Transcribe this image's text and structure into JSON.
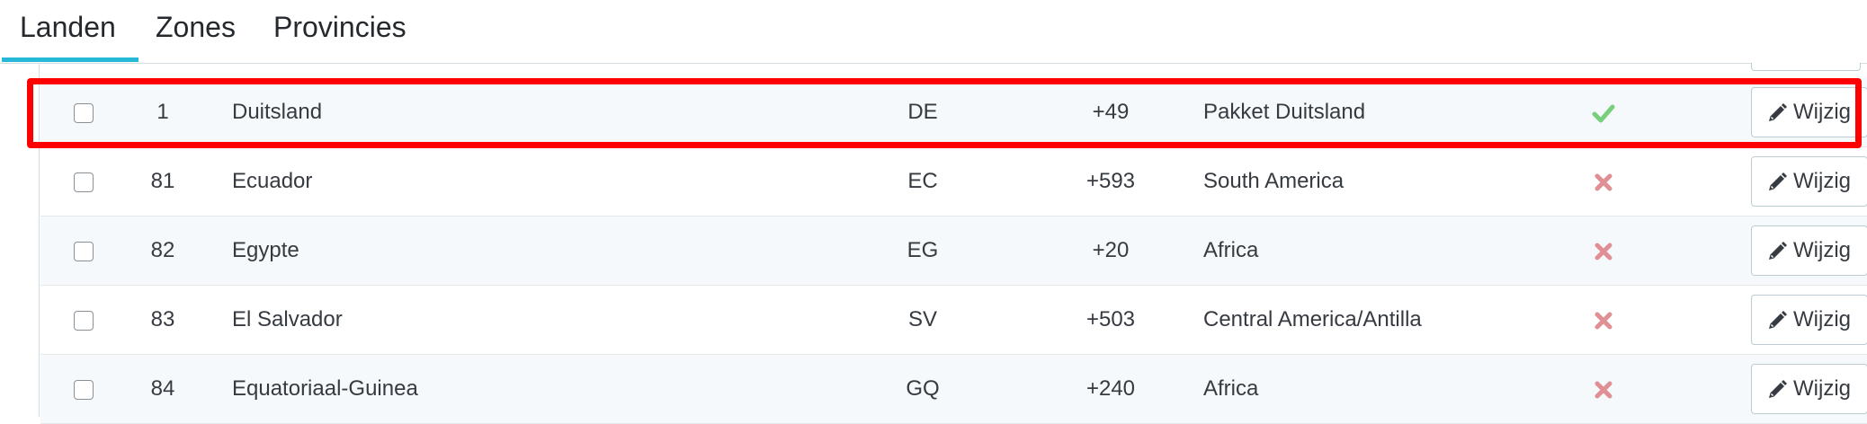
{
  "tabs": [
    {
      "label": "Landen",
      "active": true
    },
    {
      "label": "Zones",
      "active": false
    },
    {
      "label": "Provincies",
      "active": false
    }
  ],
  "colors": {
    "accent": "#25b9d7",
    "check": "#78d07d",
    "cross": "#e08f95",
    "highlight": "#ff0000"
  },
  "table": {
    "edit_label": "Wijzig",
    "rows": [
      {
        "id": "1",
        "name": "Duitsland",
        "iso": "DE",
        "call_prefix": "+49",
        "zone": "Pakket Duitsland",
        "enabled": true,
        "status_icon": "check-icon"
      },
      {
        "id": "81",
        "name": "Ecuador",
        "iso": "EC",
        "call_prefix": "+593",
        "zone": "South America",
        "enabled": false,
        "status_icon": "cross-icon"
      },
      {
        "id": "82",
        "name": "Egypte",
        "iso": "EG",
        "call_prefix": "+20",
        "zone": "Africa",
        "enabled": false,
        "status_icon": "cross-icon"
      },
      {
        "id": "83",
        "name": "El Salvador",
        "iso": "SV",
        "call_prefix": "+503",
        "zone": "Central America/Antilla",
        "enabled": false,
        "status_icon": "cross-icon"
      },
      {
        "id": "84",
        "name": "Equatoriaal-Guinea",
        "iso": "GQ",
        "call_prefix": "+240",
        "zone": "Africa",
        "enabled": false,
        "status_icon": "cross-icon"
      }
    ]
  }
}
